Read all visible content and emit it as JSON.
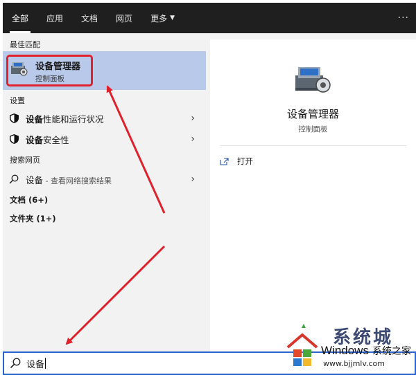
{
  "tabs": [
    {
      "label": "全部",
      "active": true
    },
    {
      "label": "应用"
    },
    {
      "label": "文档"
    },
    {
      "label": "网页"
    },
    {
      "label": "更多"
    }
  ],
  "left": {
    "best_match_label": "最佳匹配",
    "best_match": {
      "title": "设备管理器",
      "subtitle": "控制面板"
    },
    "settings_label": "设置",
    "settings_items": [
      {
        "bold": "设备",
        "rest": "性能和运行状况"
      },
      {
        "bold": "设备",
        "rest": "安全性"
      }
    ],
    "web_label": "搜索网页",
    "web_item": {
      "text": "设备",
      "hint": " - 查看网络搜索结果"
    },
    "docs_label": "文档 (6+)",
    "folders_label": "文件夹 (1+)"
  },
  "right": {
    "title": "设备管理器",
    "subtitle": "控制面板",
    "open_label": "打开"
  },
  "search": {
    "value": "设备"
  },
  "watermark": {
    "partial": "系统城",
    "title": "Windows",
    "title_cn": "系统之家",
    "url": "www.bjjmlv.com"
  },
  "colors": {
    "accent": "#2b63cf",
    "selection": "#b9c9ea",
    "annotation": "#e0212b"
  }
}
